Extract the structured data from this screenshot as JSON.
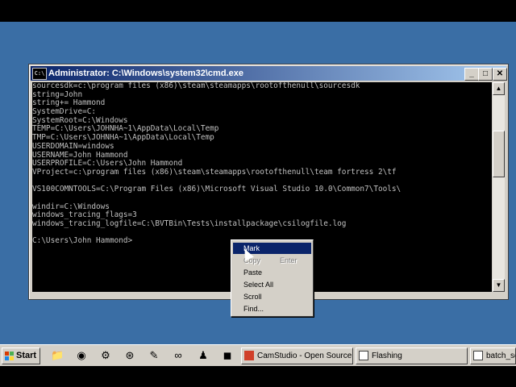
{
  "window": {
    "title": "Administrator: C:\\Windows\\system32\\cmd.exe",
    "minimize_glyph": "_",
    "maximize_glyph": "□",
    "close_glyph": "✕"
  },
  "console": {
    "lines": [
      "sourcesdk=c:\\program files (x86)\\steam\\steamapps\\rootofthenull\\sourcesdk",
      "string=John",
      "string+= Hammond",
      "SystemDrive=C:",
      "SystemRoot=C:\\Windows",
      "TEMP=C:\\Users\\JOHNHA~1\\AppData\\Local\\Temp",
      "TMP=C:\\Users\\JOHNHA~1\\AppData\\Local\\Temp",
      "USERDOMAIN=windows",
      "USERNAME=John Hammond",
      "USERPROFILE=C:\\Users\\John Hammond",
      "VProject=c:\\program files (x86)\\steam\\steamapps\\rootofthenull\\team fortress 2\\tf",
      "",
      "VS100COMNTOOLS=C:\\Program Files (x86)\\Microsoft Visual Studio 10.0\\Common7\\Tools\\",
      "",
      "windir=C:\\Windows",
      "windows_tracing_flags=3",
      "windows_tracing_logfile=C:\\BVTBin\\Tests\\installpackage\\csilogfile.log",
      "",
      "C:\\Users\\John Hammond>"
    ]
  },
  "context_menu": {
    "items": [
      {
        "label": "Mark",
        "shortcut": ""
      },
      {
        "label": "Copy",
        "shortcut": "Enter"
      },
      {
        "label": "Paste",
        "shortcut": ""
      },
      {
        "label": "Select All",
        "shortcut": ""
      },
      {
        "label": "Scroll",
        "shortcut": ""
      },
      {
        "label": "Find...",
        "shortcut": ""
      }
    ]
  },
  "taskbar": {
    "start_label": "Start",
    "quick_launch_icons": [
      "folder-icon",
      "media-icon",
      "gear-icon",
      "steam-icon",
      "notepad-icon",
      "binoculars-icon",
      "figure-icon",
      "app-icon"
    ],
    "tasks": [
      {
        "label": "CamStudio - Open Source"
      },
      {
        "label": "Flashing"
      },
      {
        "label": "batch_se"
      }
    ]
  },
  "colors": {
    "desktop": "#3a6ea5",
    "title_active": "#0a246a",
    "console_bg": "#000000",
    "console_fg": "#c0c0c0"
  }
}
